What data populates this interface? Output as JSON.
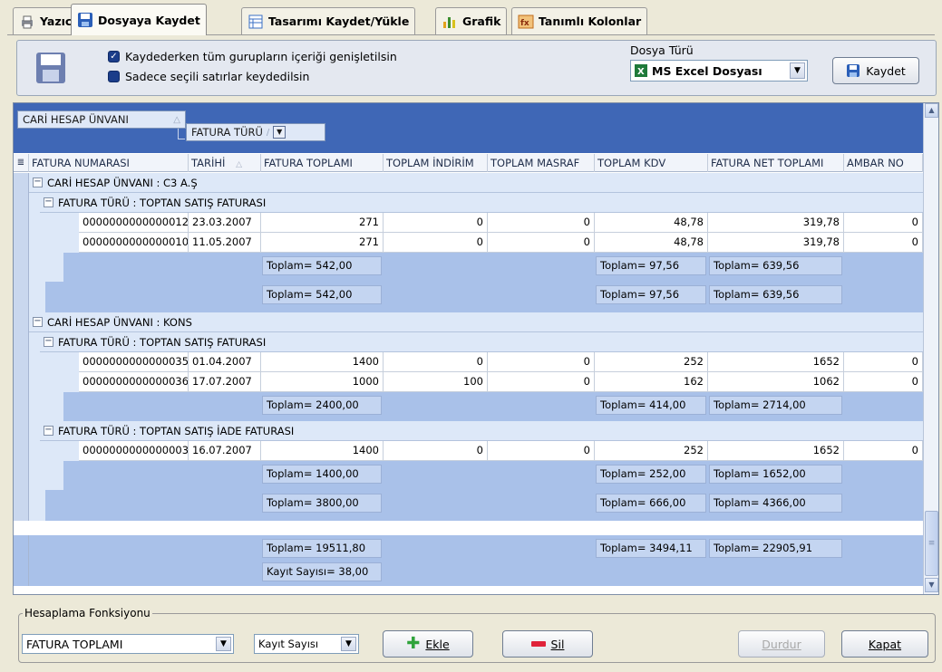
{
  "tabs": [
    {
      "label": "Yazıcı",
      "icon": "printer-icon"
    },
    {
      "label": "Dosyaya Kaydet",
      "icon": "floppy-disk-icon",
      "active": true
    },
    {
      "label": "Tasarımı Kaydet/Yükle",
      "icon": "layout-icon"
    },
    {
      "label": "Grafik",
      "icon": "bar-chart-icon"
    },
    {
      "label": "Tanımlı Kolonlar",
      "icon": "columns-icon"
    }
  ],
  "save_panel": {
    "option_expand": "Kaydederken tüm gurupların içeriği genişletilsin",
    "option_selected": "Sadece seçili satırlar keydedilsin",
    "file_type_label": "Dosya Türü",
    "file_type_value": "MS Excel Dosyası",
    "save_button": "Kaydet"
  },
  "grid": {
    "group_chips": [
      "CARİ HESAP ÜNVANI",
      "FATURA TÜRÜ"
    ],
    "columns": [
      "FATURA NUMARASI",
      "TARİHİ",
      "FATURA TOPLAMI",
      "TOPLAM İNDİRİM",
      "TOPLAM MASRAF",
      "TOPLAM KDV",
      "FATURA NET TOPLAMI",
      "AMBAR NO"
    ],
    "groups": [
      {
        "header": "CARİ HESAP ÜNVANI : C3 A.Ş",
        "subgroups": [
          {
            "header": "FATURA TÜRÜ : TOPTAN SATIŞ FATURASI",
            "rows": [
              [
                "0000000000000012",
                "23.03.2007",
                "271",
                "0",
                "0",
                "48,78",
                "319,78",
                "0"
              ],
              [
                "0000000000000010",
                "11.05.2007",
                "271",
                "0",
                "0",
                "48,78",
                "319,78",
                "0"
              ]
            ],
            "sums": [
              "Toplam= 542,00",
              "Toplam= 97,56",
              "Toplam= 639,56"
            ]
          }
        ],
        "sums": [
          "Toplam= 542,00",
          "Toplam= 97,56",
          "Toplam= 639,56"
        ]
      },
      {
        "header": "CARİ HESAP ÜNVANI : KONS",
        "subgroups": [
          {
            "header": "FATURA TÜRÜ : TOPTAN SATIŞ FATURASI",
            "rows": [
              [
                "0000000000000035",
                "01.04.2007",
                "1400",
                "0",
                "0",
                "252",
                "1652",
                "0"
              ],
              [
                "0000000000000036",
                "17.07.2007",
                "1000",
                "100",
                "0",
                "162",
                "1062",
                "0"
              ]
            ],
            "sums": [
              "Toplam= 2400,00",
              "Toplam= 414,00",
              "Toplam= 2714,00"
            ]
          },
          {
            "header": "FATURA TÜRÜ : TOPTAN SATIŞ İADE FATURASI",
            "rows": [
              [
                "0000000000000003",
                "16.07.2007",
                "1400",
                "0",
                "0",
                "252",
                "1652",
                "0"
              ]
            ],
            "sums": [
              "Toplam= 1400,00",
              "Toplam= 252,00",
              "Toplam= 1652,00"
            ]
          }
        ],
        "sums": [
          "Toplam= 3800,00",
          "Toplam= 666,00",
          "Toplam= 4366,00"
        ]
      }
    ],
    "footer": {
      "sums": [
        "Toplam= 19511,80",
        "Toplam= 3494,11",
        "Toplam= 22905,91"
      ],
      "count": "Kayıt Sayısı= 38,00"
    }
  },
  "bottom": {
    "legend": "Hesaplama Fonksiyonu",
    "column_value": "FATURA TOPLAMI",
    "function_value": "Kayıt Sayısı",
    "add_button": "Ekle",
    "delete_button": "Sil",
    "stop_button": "Durdur",
    "close_button": "Kapat"
  }
}
